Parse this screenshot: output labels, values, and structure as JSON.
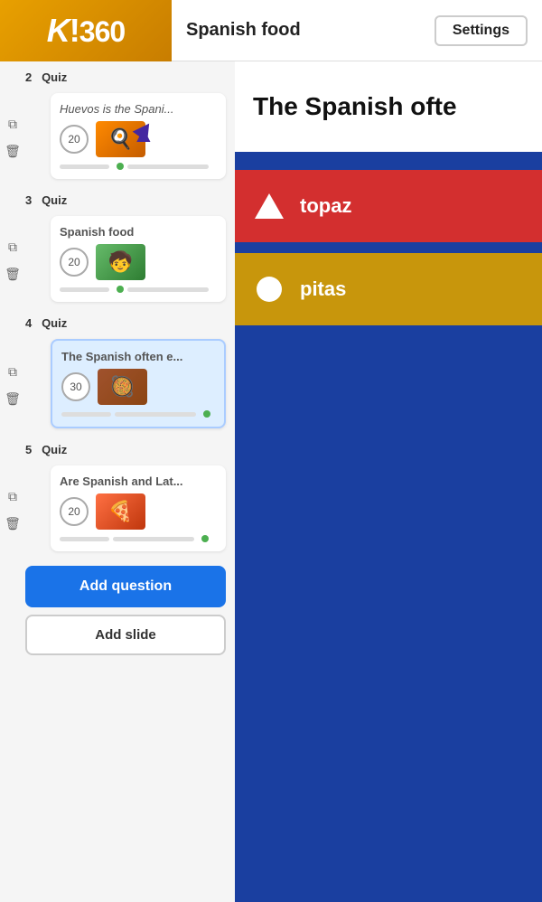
{
  "header": {
    "logo": "K!360",
    "title": "Spanish food",
    "settings_label": "Settings"
  },
  "sidebar": {
    "sections": [
      {
        "number": "2",
        "type": "Quiz",
        "items": [
          {
            "id": "quiz-2",
            "title": "Huevos is the Spani...",
            "italic": true,
            "points": 20,
            "thumb_emoji": "🍳",
            "thumb_class": "thumb-orange",
            "active": false,
            "has_cursor": true
          }
        ]
      },
      {
        "number": "3",
        "type": "Quiz",
        "items": [
          {
            "id": "quiz-3",
            "title": "Spanish food",
            "italic": false,
            "points": 20,
            "thumb_emoji": "🧒",
            "thumb_class": "thumb-green",
            "active": false,
            "has_cursor": false
          }
        ]
      },
      {
        "number": "4",
        "type": "Quiz",
        "items": [
          {
            "id": "quiz-4",
            "title": "The Spanish often e...",
            "italic": false,
            "points": 30,
            "thumb_emoji": "🥘",
            "thumb_class": "thumb-brown",
            "active": true,
            "has_cursor": false
          }
        ]
      },
      {
        "number": "5",
        "type": "Quiz",
        "items": [
          {
            "id": "quiz-5",
            "title": "Are Spanish and Lat...",
            "italic": false,
            "points": 20,
            "thumb_emoji": "🍕",
            "thumb_class": "thumb-pizza",
            "active": false,
            "has_cursor": false
          }
        ]
      }
    ],
    "add_question_label": "Add question",
    "add_slide_label": "Add slide"
  },
  "preview": {
    "question_text": "The Spanish ofte",
    "answers": [
      {
        "shape": "triangle",
        "label": "topaz",
        "color": "red"
      },
      {
        "shape": "circle",
        "label": "pitas",
        "color": "gold"
      }
    ]
  }
}
